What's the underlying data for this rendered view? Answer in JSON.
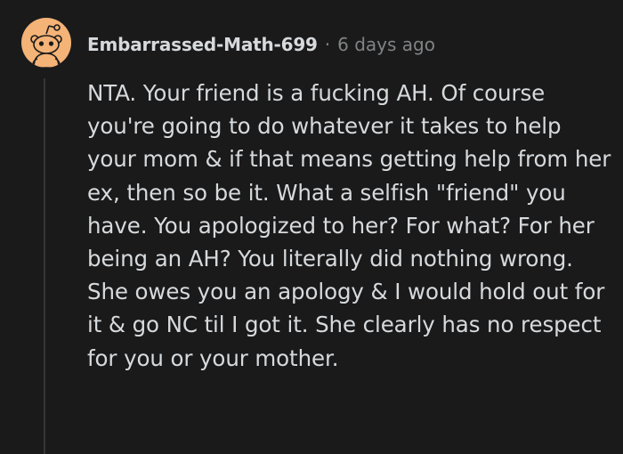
{
  "comment": {
    "avatar_icon": "snoo-avatar-icon",
    "avatar_color": "#f4b377",
    "username": "Embarrassed-Math-699",
    "separator": "·",
    "timestamp": "6 days ago",
    "body": "NTA. Your friend is a fucking AH. Of course you're going to do whatever it takes to help your mom & if that means getting help from her ex, then so be it. What a selfish \"friend\" you have. You apologized to her? For what? For her being an AH? You literally did nothing wrong. She owes you an apology & I would hold out for it & go NC til I got it. She clearly has no respect for you or your mother."
  },
  "colors": {
    "background": "#1a1a1b",
    "text": "#d7dadc",
    "muted": "#818384",
    "thread_line": "#343536"
  }
}
